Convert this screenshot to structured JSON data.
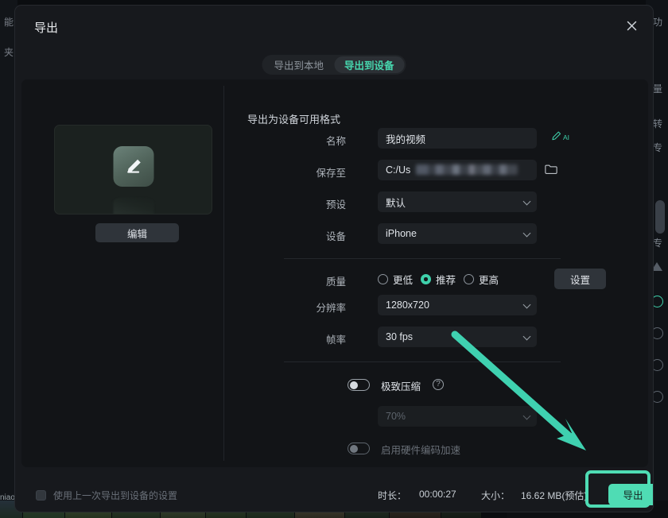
{
  "theme": {
    "accent": "#4fdcb4",
    "accent_text": "#47d6ae",
    "modal_bg": "#17191d",
    "card_bg": "#121417",
    "field_bg": "#1e2125",
    "text_primary": "#dfe3e8",
    "text_secondary": "#aeb4bb",
    "text_disabled": "#696f77"
  },
  "window": {
    "title": "导出",
    "close_icon": "close-icon"
  },
  "tabs": [
    {
      "label": "导出到本地",
      "active": false
    },
    {
      "label": "导出到设备",
      "active": true
    }
  ],
  "preview": {
    "icon": "pencil-edit-icon",
    "edit_label": "编辑"
  },
  "form": {
    "section_title": "导出为设备可用格式",
    "fields": [
      {
        "label": "名称",
        "value": "我的视频",
        "type": "text"
      },
      {
        "label": "保存至",
        "value": "C:/Us",
        "value_masked": true,
        "type": "path",
        "icon": "folder-icon"
      },
      {
        "label": "预设",
        "value": "默认",
        "type": "select"
      },
      {
        "label": "设备",
        "value": "iPhone",
        "type": "select"
      }
    ],
    "ai_rename": {
      "icon": "ai-pencil-icon",
      "label": "AI"
    },
    "settings_label": "设置",
    "quality": {
      "label": "质量",
      "options": [
        "更低",
        "推荐",
        "更高"
      ],
      "selected": "推荐"
    },
    "resolution": {
      "label": "分辨率",
      "value": "1280x720"
    },
    "framerate": {
      "label": "帧率",
      "value": "30 fps"
    },
    "extreme_compression": {
      "label": "极致压缩",
      "enabled": false,
      "help_icon": "question-mark-icon",
      "level_value": "70%",
      "level_disabled": true
    },
    "hardware_accel": {
      "label": "启用硬件编码加速",
      "enabled": false,
      "disabled": true
    }
  },
  "footer": {
    "reuse_settings_label": "使用上一次导出到设备的设置",
    "reuse_settings_checked": false,
    "duration_label": "时长：",
    "duration_value": "00:00:27",
    "size_label": "大小：",
    "size_value": "16.62 MB(预估)",
    "export_label": "导出"
  },
  "background": {
    "left_chars": [
      "能",
      "夹"
    ],
    "right_chars": [
      "功",
      "量",
      "转",
      "专",
      "专"
    ],
    "bottom_text": "niao"
  }
}
